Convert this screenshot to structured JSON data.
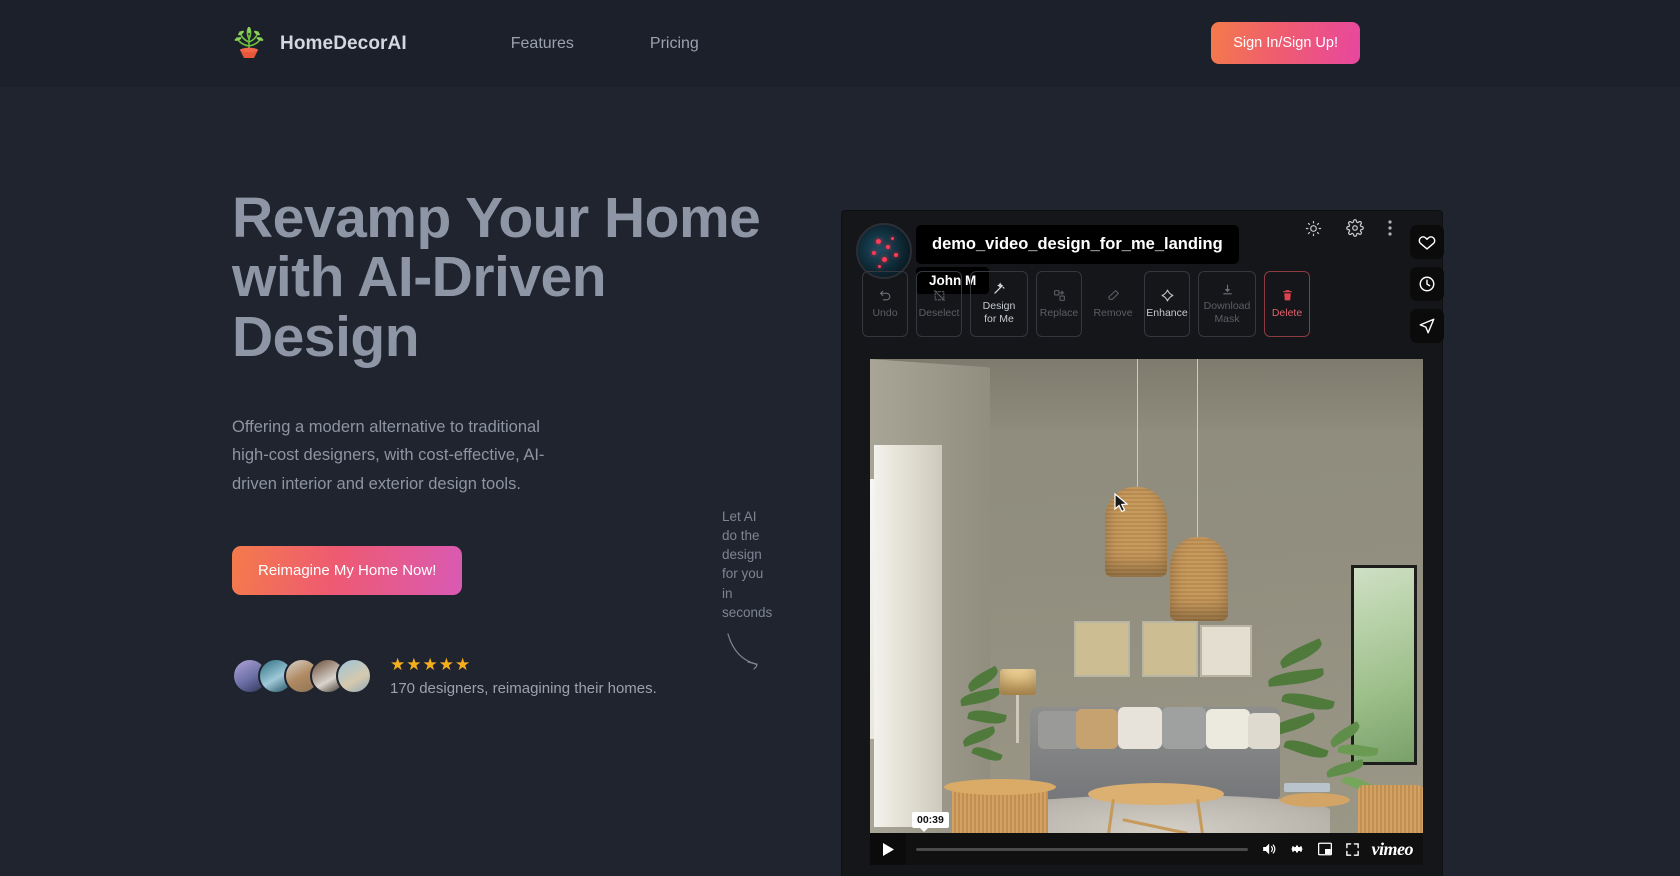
{
  "header": {
    "brand_name": "HomeDecorAI",
    "logo_icon": "potted-plant-icon",
    "nav": [
      {
        "label": "Features"
      },
      {
        "label": "Pricing"
      }
    ],
    "signin_label": "Sign In/Sign Up!"
  },
  "hero": {
    "headline": "Revamp Your Home\nwith AI-Driven\nDesign",
    "subcopy": "Offering a modern alternative to traditional high-cost designers, with cost-effective, AI-driven interior and exterior design tools.",
    "cta_label": "Reimagine My Home Now!",
    "sidenote": "Let AI do the design for you in seconds",
    "stars": "★★★★★",
    "social_proof": "170 designers, reimagining their homes."
  },
  "app": {
    "file_name": "demo_video_design_for_me_landing",
    "user_name": "John M",
    "avatar_icon": "brain-avatar",
    "top_icons": [
      {
        "name": "brightness-icon"
      },
      {
        "name": "gear-icon"
      },
      {
        "name": "more-vertical-icon"
      }
    ],
    "rail_icons": [
      {
        "name": "heart-icon"
      },
      {
        "name": "clock-icon"
      },
      {
        "name": "send-icon"
      }
    ],
    "toolbar": [
      {
        "label": "Undo",
        "icon": "undo-icon",
        "state": "dim"
      },
      {
        "label": "Deselect",
        "icon": "deselect-icon",
        "state": "dim"
      },
      {
        "label": "Design\nfor Me",
        "icon": "magic-wand-icon",
        "state": "active"
      },
      {
        "label": "Replace",
        "icon": "replace-icon",
        "state": "dim"
      },
      {
        "label": "Remove",
        "icon": "eraser-icon",
        "state": "dim"
      },
      {
        "label": "Enhance",
        "icon": "sparkle-icon",
        "state": "active"
      },
      {
        "label": "Download\nMask",
        "icon": "download-icon",
        "state": "dim"
      },
      {
        "label": "Delete",
        "icon": "trash-icon",
        "state": "danger"
      }
    ],
    "player": {
      "time": "00:39",
      "progress_percent": 0,
      "brand": "vimeo",
      "controls": [
        {
          "name": "play-button"
        },
        {
          "name": "volume-icon"
        },
        {
          "name": "settings-gear-icon"
        },
        {
          "name": "picture-in-picture-icon"
        },
        {
          "name": "fullscreen-icon"
        }
      ]
    }
  },
  "colors": {
    "page_bg": "#1f242e",
    "header_bg": "#1b202a",
    "accent_orange": "#f47b4b",
    "accent_pink": "#e8479f",
    "star_gold": "#f5ae1c",
    "danger_red": "#e0616e"
  }
}
